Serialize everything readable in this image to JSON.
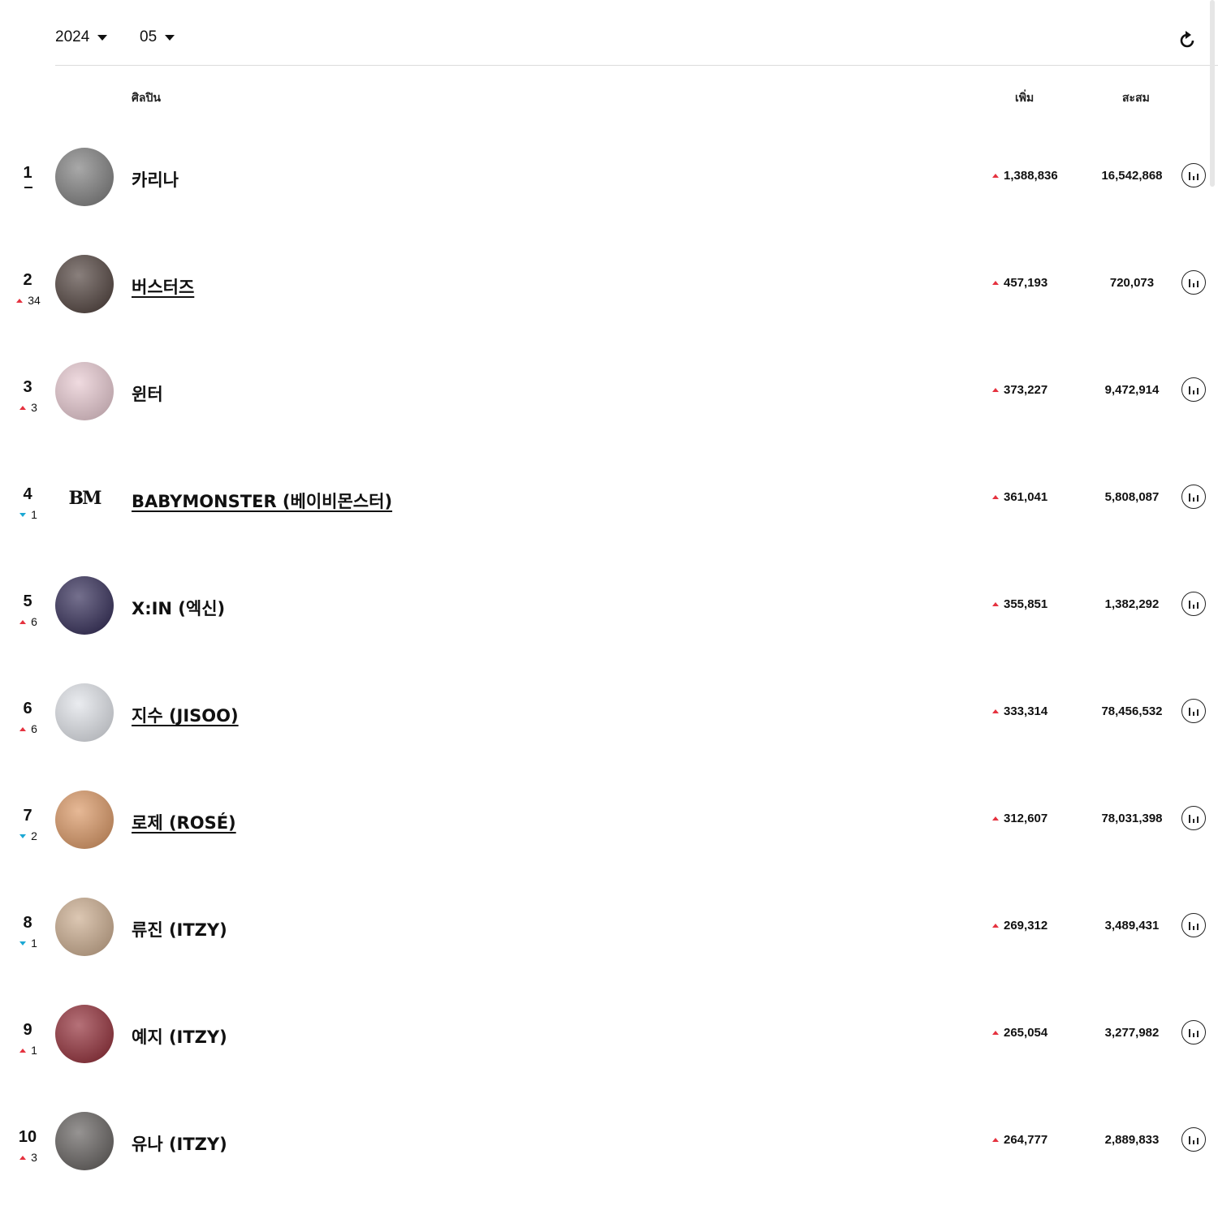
{
  "filters": {
    "year": "2024",
    "month": "05"
  },
  "icons": {
    "refresh": "refresh-icon",
    "chart": "bar-chart-icon"
  },
  "colors": {
    "up": "#e5323f",
    "down": "#1ca8d4"
  },
  "columns": {
    "artist": "ศิลปิน",
    "increase": "เพิ่ม",
    "total": "สะสม"
  },
  "rows": [
    {
      "rank": "1",
      "trend": "same",
      "change": "",
      "name": "카리나",
      "linked": false,
      "increase": "1,388,836",
      "total": "16,542,868",
      "avatar_color": "#7a7a7a"
    },
    {
      "rank": "2",
      "trend": "up",
      "change": "34",
      "name": "버스터즈",
      "linked": true,
      "increase": "457,193",
      "total": "720,073",
      "avatar_color": "#4a3b36"
    },
    {
      "rank": "3",
      "trend": "up",
      "change": "3",
      "name": "윈터",
      "linked": false,
      "increase": "373,227",
      "total": "9,472,914",
      "avatar_color": "#e7c7cf"
    },
    {
      "rank": "4",
      "trend": "down",
      "change": "1",
      "name": "BABYMONSTER (베이비몬스터)",
      "linked": true,
      "increase": "361,041",
      "total": "5,808,087",
      "avatar_color": "#ffffff",
      "logo": "BM"
    },
    {
      "rank": "5",
      "trend": "up",
      "change": "6",
      "name": "X:IN (엑신)",
      "linked": false,
      "increase": "355,851",
      "total": "1,382,292",
      "avatar_color": "#2a2350"
    },
    {
      "rank": "6",
      "trend": "up",
      "change": "6",
      "name": "지수 (JISOO)",
      "linked": true,
      "increase": "333,314",
      "total": "78,456,532",
      "avatar_color": "#dfe2e8"
    },
    {
      "rank": "7",
      "trend": "down",
      "change": "2",
      "name": "로제 (ROSÉ)",
      "linked": true,
      "increase": "312,607",
      "total": "78,031,398",
      "avatar_color": "#d9935e"
    },
    {
      "rank": "8",
      "trend": "down",
      "change": "1",
      "name": "류진 (ITZY)",
      "linked": false,
      "increase": "269,312",
      "total": "3,489,431",
      "avatar_color": "#c9a98a"
    },
    {
      "rank": "9",
      "trend": "up",
      "change": "1",
      "name": "예지 (ITZY)",
      "linked": false,
      "increase": "265,054",
      "total": "3,277,982",
      "avatar_color": "#8e2530"
    },
    {
      "rank": "10",
      "trend": "up",
      "change": "3",
      "name": "유나 (ITZY)",
      "linked": false,
      "increase": "264,777",
      "total": "2,889,833",
      "avatar_color": "#5e5a58"
    }
  ]
}
